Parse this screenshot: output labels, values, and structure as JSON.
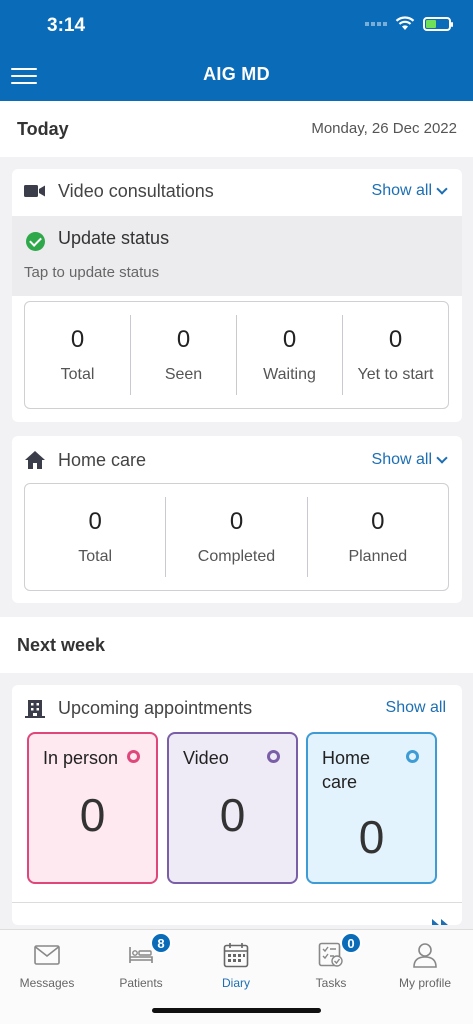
{
  "status_bar": {
    "time": "3:14"
  },
  "header": {
    "title": "AIG MD"
  },
  "today": {
    "label": "Today",
    "date": "Monday, 26 Dec 2022"
  },
  "video_consultations": {
    "title": "Video consultations",
    "show_all": "Show all",
    "update_status": {
      "title": "Update status",
      "subtitle": "Tap to update status"
    },
    "stats": [
      {
        "value": "0",
        "label": "Total"
      },
      {
        "value": "0",
        "label": "Seen"
      },
      {
        "value": "0",
        "label": "Waiting"
      },
      {
        "value": "0",
        "label": "Yet to start"
      }
    ]
  },
  "home_care": {
    "title": "Home care",
    "show_all": "Show all",
    "stats": [
      {
        "value": "0",
        "label": "Total"
      },
      {
        "value": "0",
        "label": "Completed"
      },
      {
        "value": "0",
        "label": "Planned"
      }
    ]
  },
  "next_week": {
    "label": "Next week"
  },
  "upcoming": {
    "title": "Upcoming appointments",
    "show_all": "Show all",
    "tiles": [
      {
        "label": "In person",
        "value": "0",
        "border": "#e0457b",
        "bg": "#fde9ef",
        "dot": "#e0457b"
      },
      {
        "label": "Video",
        "value": "0",
        "border": "#7a5ea8",
        "bg": "#efebf6",
        "dot": "#7a5ea8"
      },
      {
        "label": "Home care",
        "value": "0",
        "border": "#3d9bd6",
        "bg": "#e3f3fd",
        "dot": "#3d9bd6"
      }
    ]
  },
  "tabbar": {
    "items": [
      {
        "label": "Messages",
        "icon": "envelope-icon"
      },
      {
        "label": "Patients",
        "icon": "bed-icon",
        "badge": "8"
      },
      {
        "label": "Diary",
        "icon": "calendar-icon",
        "active": true
      },
      {
        "label": "Tasks",
        "icon": "checklist-icon",
        "badge": "0"
      },
      {
        "label": "My profile",
        "icon": "person-icon"
      }
    ]
  },
  "colors": {
    "primary": "#0a6cb8",
    "link": "#1d6fb3",
    "success": "#2ea84a"
  }
}
